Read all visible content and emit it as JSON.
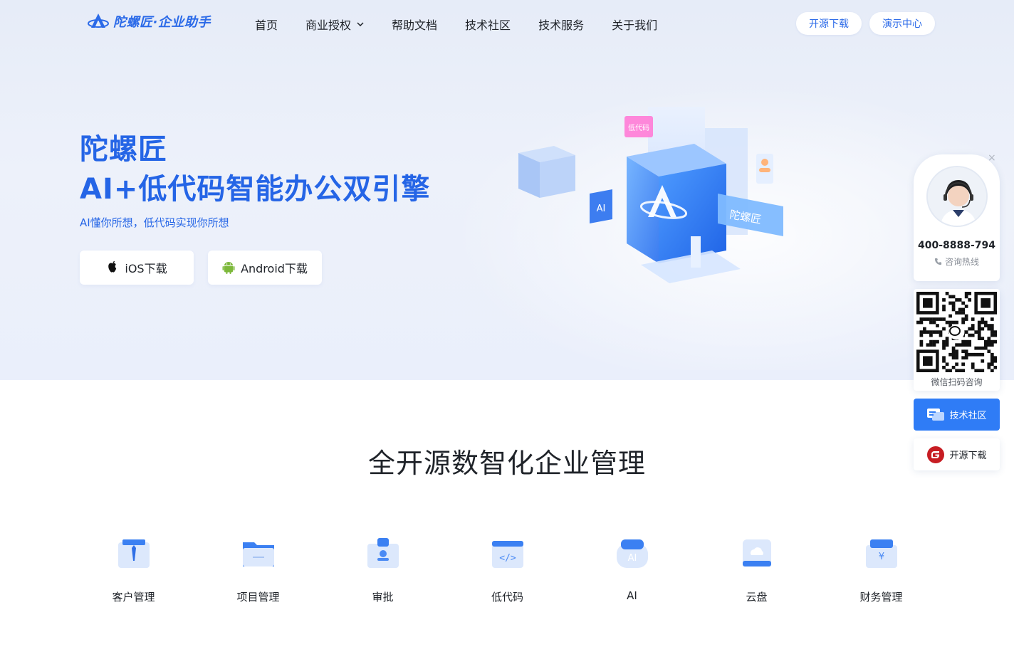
{
  "nav": {
    "logo_text": "陀螺匠·企业助手",
    "menu": [
      {
        "label": "首页"
      },
      {
        "label": "商业授权"
      },
      {
        "label": "帮助文档"
      },
      {
        "label": "技术社区"
      },
      {
        "label": "技术服务"
      },
      {
        "label": "关于我们"
      }
    ],
    "btn_download": "开源下载",
    "btn_demo": "演示中心"
  },
  "hero": {
    "title_line1": "陀螺匠",
    "title_line2": "AI+低代码智能办公双引擎",
    "subtitle": "AI懂你所想，低代码实现你所想",
    "ios_label": "iOS下载",
    "android_label": "Android下载",
    "illus_tag_lowcode": "低代码",
    "illus_tag_ai": "AI",
    "illus_tag_brand": "陀螺匠"
  },
  "section": {
    "title": "全开源数智化企业管理",
    "features": [
      {
        "label": "客户管理",
        "icon": "customer-icon"
      },
      {
        "label": "项目管理",
        "icon": "folder-icon"
      },
      {
        "label": "审批",
        "icon": "approval-icon"
      },
      {
        "label": "低代码",
        "icon": "code-icon"
      },
      {
        "label": "AI",
        "icon": "ai-icon"
      },
      {
        "label": "云盘",
        "icon": "cloud-icon"
      },
      {
        "label": "财务管理",
        "icon": "finance-icon"
      }
    ]
  },
  "side": {
    "close": "×",
    "phone": "400-8888-794",
    "hotline": "咨询热线",
    "qr_label": "微信扫码咨询",
    "community": "技术社区",
    "download": "开源下载"
  },
  "colors": {
    "brand": "#2565e6",
    "side_active": "#2f7cf6"
  }
}
